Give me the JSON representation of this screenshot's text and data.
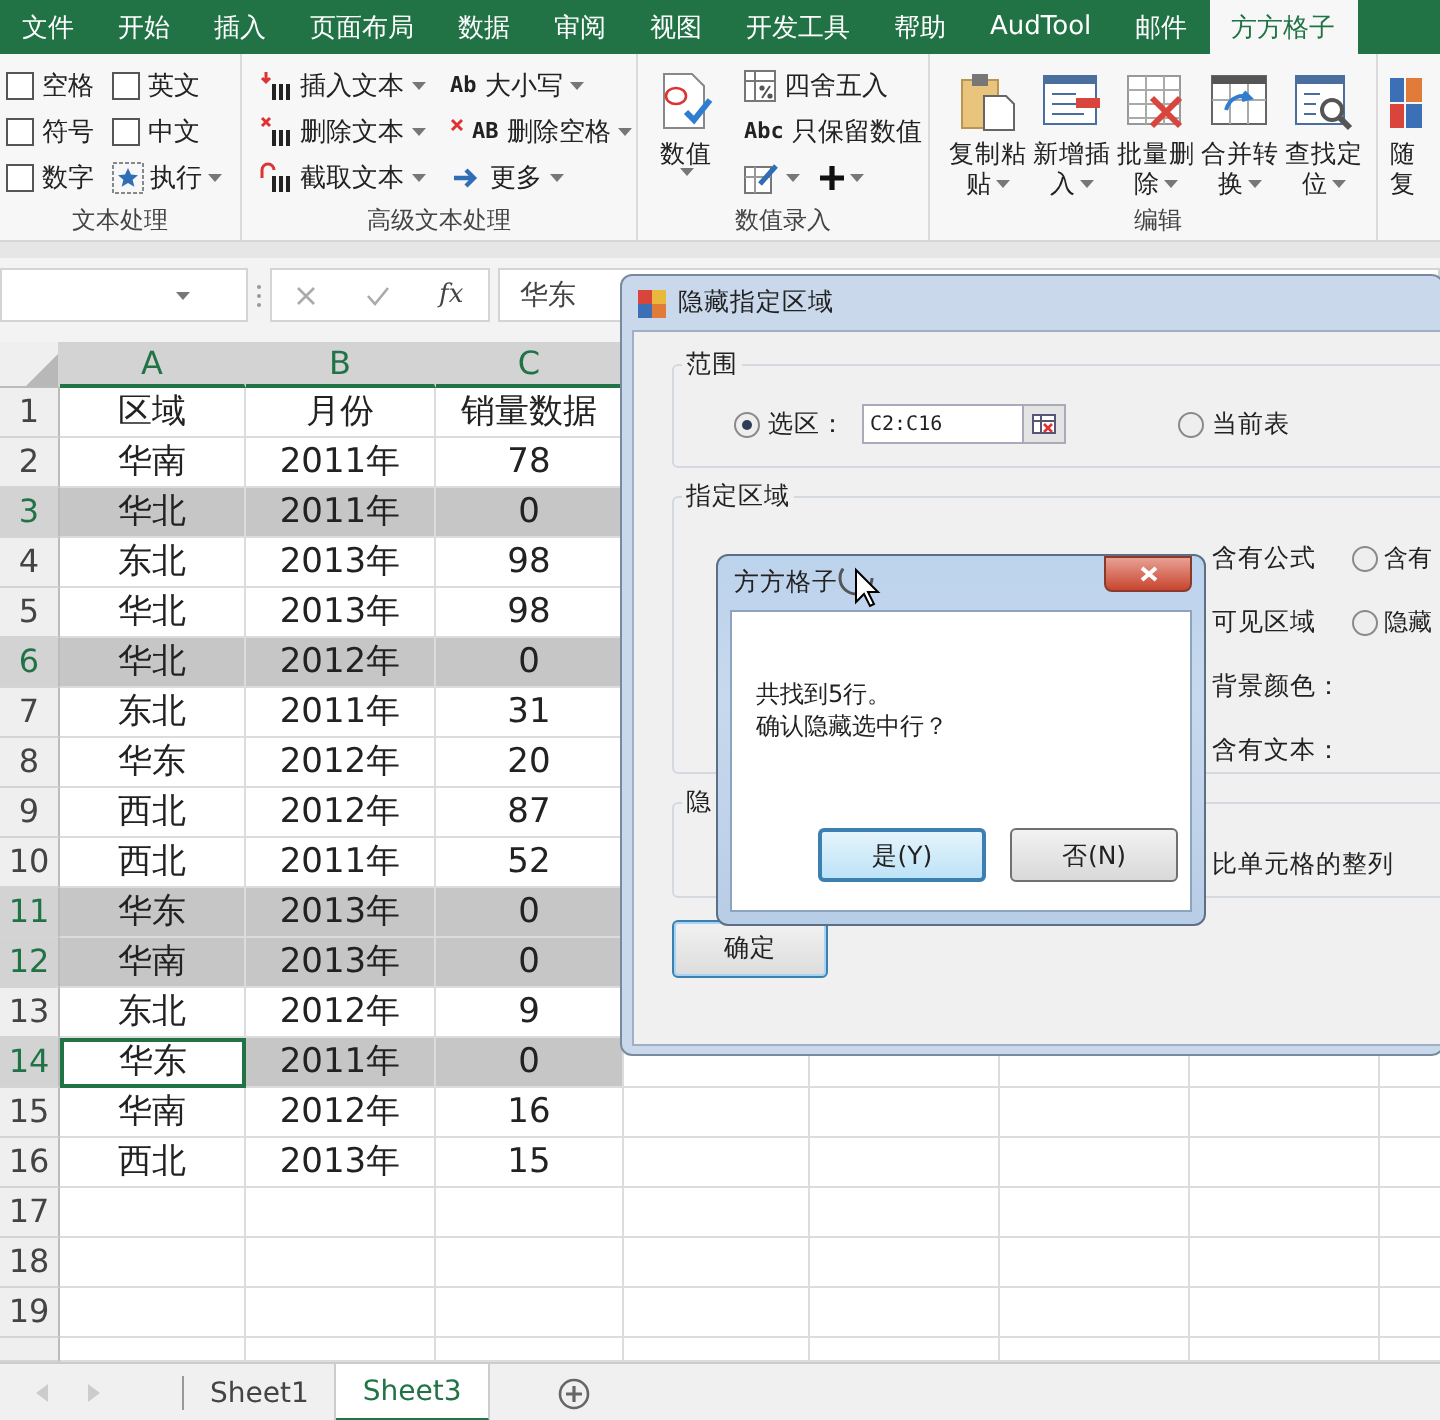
{
  "ribbon_tabs": [
    {
      "label": "文件",
      "selected": false
    },
    {
      "label": "开始",
      "selected": false
    },
    {
      "label": "插入",
      "selected": false
    },
    {
      "label": "页面布局",
      "selected": false
    },
    {
      "label": "数据",
      "selected": false
    },
    {
      "label": "审阅",
      "selected": false
    },
    {
      "label": "视图",
      "selected": false
    },
    {
      "label": "开发工具",
      "selected": false
    },
    {
      "label": "帮助",
      "selected": false
    },
    {
      "label": "AudTool",
      "selected": false
    },
    {
      "label": "邮件",
      "selected": false
    },
    {
      "label": "方方格子",
      "selected": true
    }
  ],
  "ribbon_groups": [
    {
      "kind": "checks",
      "label": "文本处理",
      "checkboxes": [
        {
          "label": "空格",
          "checked": false
        },
        {
          "label": "英文",
          "checked": false
        },
        {
          "label": "符号",
          "checked": false
        },
        {
          "label": "中文",
          "checked": false
        },
        {
          "label": "数字",
          "checked": false
        }
      ],
      "run_button": "执行"
    },
    {
      "kind": "text_tools",
      "label": "高级文本处理",
      "items": [
        {
          "label": "插入文本",
          "dropdown": true
        },
        {
          "label": "删除文本",
          "dropdown": true
        },
        {
          "label": "截取文本",
          "dropdown": true
        },
        {
          "badge": "Ab",
          "label": "大小写",
          "dropdown": true
        },
        {
          "badge": "AB",
          "label": "删除空格",
          "dropdown": true
        },
        {
          "label": "更多",
          "dropdown": true
        }
      ]
    },
    {
      "kind": "number_entry",
      "label": "数值录入",
      "large_button": "数值",
      "items": [
        {
          "label": "四舍五入",
          "dropdown": false
        },
        {
          "badge": "Abc",
          "label": "只保留数值",
          "dropdown": false
        }
      ]
    },
    {
      "kind": "edit",
      "label": "编辑",
      "buttons": [
        {
          "lines": [
            "复制粘",
            "贴"
          ]
        },
        {
          "lines": [
            "新增插",
            "入"
          ]
        },
        {
          "lines": [
            "批量删",
            "除"
          ]
        },
        {
          "lines": [
            "合并转",
            "换"
          ]
        },
        {
          "lines": [
            "查找定",
            "位"
          ]
        }
      ]
    },
    {
      "kind": "partial",
      "lines": [
        "随",
        "复"
      ]
    }
  ],
  "formula_bar": {
    "function_label": "fx",
    "value": "华东"
  },
  "sheet": {
    "columns": [
      {
        "label": "A",
        "selected": true
      },
      {
        "label": "B",
        "selected": true
      },
      {
        "label": "C",
        "selected": true
      }
    ],
    "rows": [
      {
        "number": "1",
        "selected": false,
        "active": false,
        "cells": [
          "区域",
          "月份",
          "销量数据"
        ]
      },
      {
        "number": "2",
        "selected": false,
        "active": false,
        "cells": [
          "华南",
          "2011年",
          "78"
        ]
      },
      {
        "number": "3",
        "selected": true,
        "active": false,
        "cells": [
          "华北",
          "2011年",
          "0"
        ]
      },
      {
        "number": "4",
        "selected": false,
        "active": false,
        "cells": [
          "东北",
          "2013年",
          "98"
        ]
      },
      {
        "number": "5",
        "selected": false,
        "active": false,
        "cells": [
          "华北",
          "2013年",
          "98"
        ]
      },
      {
        "number": "6",
        "selected": true,
        "active": false,
        "cells": [
          "华北",
          "2012年",
          "0"
        ]
      },
      {
        "number": "7",
        "selected": false,
        "active": false,
        "cells": [
          "东北",
          "2011年",
          "31"
        ]
      },
      {
        "number": "8",
        "selected": false,
        "active": false,
        "cells": [
          "华东",
          "2012年",
          "20"
        ]
      },
      {
        "number": "9",
        "selected": false,
        "active": false,
        "cells": [
          "西北",
          "2012年",
          "87"
        ]
      },
      {
        "number": "10",
        "selected": false,
        "active": false,
        "cells": [
          "西北",
          "2011年",
          "52"
        ]
      },
      {
        "number": "11",
        "selected": true,
        "active": false,
        "cells": [
          "华东",
          "2013年",
          "0"
        ]
      },
      {
        "number": "12",
        "selected": true,
        "active": false,
        "cells": [
          "华南",
          "2013年",
          "0"
        ]
      },
      {
        "number": "13",
        "selected": false,
        "active": false,
        "cells": [
          "东北",
          "2012年",
          "9"
        ]
      },
      {
        "number": "14",
        "selected": true,
        "active": true,
        "cells": [
          "华东",
          "2011年",
          "0"
        ]
      },
      {
        "number": "15",
        "selected": false,
        "active": false,
        "cells": [
          "华南",
          "2012年",
          "16"
        ]
      },
      {
        "number": "16",
        "selected": false,
        "active": false,
        "cells": [
          "西北",
          "2013年",
          "15"
        ]
      },
      {
        "number": "17",
        "selected": false,
        "active": false
      },
      {
        "number": "18",
        "selected": false,
        "active": false
      },
      {
        "number": "19",
        "selected": false,
        "active": false
      }
    ]
  },
  "sheet_tabs": [
    {
      "label": "Sheet1",
      "selected": false
    },
    {
      "label": "Sheet3",
      "selected": true
    }
  ],
  "dialog": {
    "title": "隐藏指定区域",
    "range": {
      "label": "范围",
      "value": "C2:C16",
      "options": [
        {
          "label": "选区：",
          "selected": true
        },
        {
          "label": "当前表",
          "selected": false
        }
      ]
    },
    "area": {
      "label": "指定区域",
      "conditions": [
        "含有公式",
        "可见区域",
        "背景颜色：",
        "含有文本："
      ],
      "options": [
        {
          "label": "含有",
          "selected": false
        },
        {
          "label": "隐藏",
          "selected": false
        }
      ]
    },
    "hide": {
      "label": "隐",
      "option": "比单元格的整列"
    },
    "ok_button": "确定"
  },
  "message_box": {
    "title": "方方格子",
    "lines": [
      "共找到5行。",
      "确认隐藏选中行？"
    ],
    "buttons": [
      {
        "label": "是(Y)",
        "focused": true
      },
      {
        "label": "否(N)",
        "focused": false
      }
    ]
  }
}
